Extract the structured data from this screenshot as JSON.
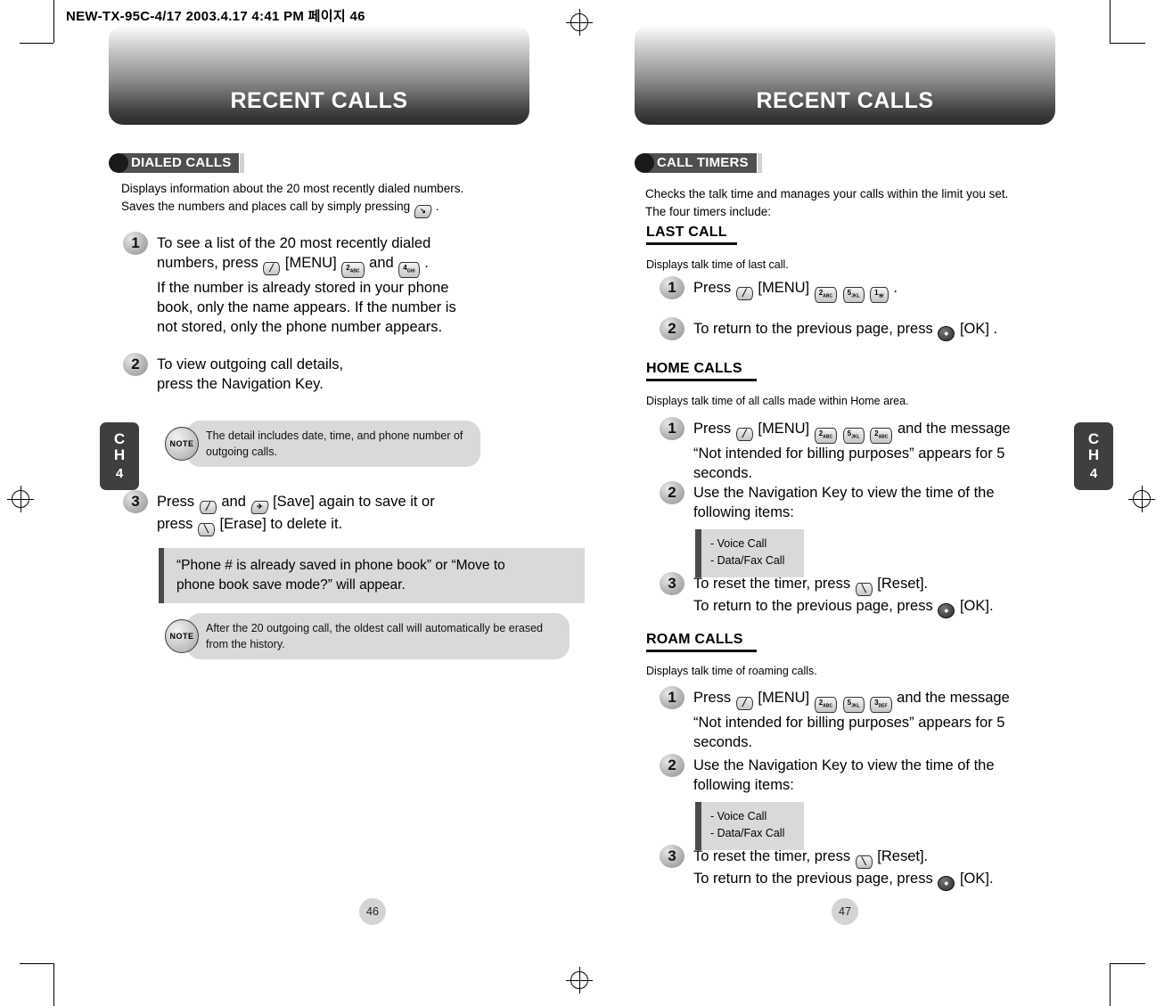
{
  "header_code": "NEW-TX-95C-4/17  2003.4.17 4:41 PM 페이지 46",
  "left_page": {
    "title": "RECENT CALLS",
    "section": "DIALED CALLS",
    "intro_line1": "Displays information about the 20 most recently dialed numbers.",
    "intro_line2_a": "Saves the numbers and places call by simply pressing",
    "intro_line2_b": ".",
    "steps": [
      {
        "num": "1",
        "text_a": "To see a list of the 20 most recently dialed",
        "text_b": "numbers, press",
        "menu": "[MENU]",
        "and": "and",
        "dot": ".",
        "text_c": "If the number is already stored in your phone",
        "text_d": "book, only the name appears. If the number is",
        "text_e": "not stored, only the phone number appears."
      },
      {
        "num": "2",
        "text_a": "To view outgoing call details,",
        "text_b": "press the Navigation Key."
      },
      {
        "num": "3",
        "text_a": "Press",
        "text_b": "and",
        "save": "[Save]",
        "text_c": "again to save it or",
        "text_d": "press",
        "erase": "[Erase]",
        "text_e": "to delete it."
      }
    ],
    "note1": "The detail includes date, time, and phone number of outgoing calls.",
    "note2": "After the 20 outgoing call, the oldest call will automatically be erased from the history.",
    "callout_a": "“Phone # is already saved in phone book” or “Move to",
    "callout_b": "phone book save mode?” will appear.",
    "note_badge": "NOTE",
    "page_number": "46",
    "chapter_letter_c": "CH",
    "chapter_number": "4"
  },
  "right_page": {
    "title": "RECENT CALLS",
    "section": "CALL TIMERS",
    "intro_line1": "Checks the talk time and manages your calls within the limit you set.",
    "intro_line2": "The four timers include:",
    "last_call": {
      "heading": "LAST CALL",
      "desc": "Displays talk time of last call.",
      "steps": [
        {
          "num": "1",
          "text_a": "Press",
          "menu": "[MENU]",
          "dot": "."
        },
        {
          "num": "2",
          "text_a": "To return to the previous page, press",
          "ok": "[OK] ."
        }
      ]
    },
    "home_calls": {
      "heading": "HOME CALLS",
      "desc": "Displays talk time of all calls made within Home area.",
      "steps": [
        {
          "num": "1",
          "text_a": "Press",
          "menu": "[MENU]",
          "text_b": "and the message",
          "text_c": "“Not intended for billing purposes” appears for 5",
          "text_d": "seconds."
        },
        {
          "num": "2",
          "text_a": "Use the Navigation Key to view the time of the",
          "text_b": "following items:"
        },
        {
          "num": "3",
          "text_a": "To reset the timer, press",
          "reset": "[Reset].",
          "text_b": "To return to the previous page, press",
          "ok": "[OK]."
        }
      ],
      "items": [
        "- Voice Call",
        "- Data/Fax Call"
      ]
    },
    "roam_calls": {
      "heading": "ROAM CALLS",
      "desc": "Displays talk time of roaming calls.",
      "steps": [
        {
          "num": "1",
          "text_a": "Press",
          "menu": "[MENU]",
          "text_b": "and the message",
          "text_c": "“Not intended for billing purposes” appears for 5",
          "text_d": "seconds."
        },
        {
          "num": "2",
          "text_a": "Use the Navigation Key to view the time of the",
          "text_b": "following items:"
        },
        {
          "num": "3",
          "text_a": "To reset the timer, press",
          "reset": "[Reset].",
          "text_b": "To return to the previous page, press",
          "ok": "[OK]."
        }
      ],
      "items": [
        "- Voice Call",
        "- Data/Fax Call"
      ]
    },
    "page_number": "47",
    "chapter_letter_c": "CH",
    "chapter_number": "4"
  },
  "keys": {
    "send": "↘",
    "menu_soft": "╱",
    "num2": "2ᴀᴃᴄ",
    "num3": "3ᴅᴇᴟ",
    "num4": "4ɢʜɪ",
    "num5": "5ᴊᴋʟ",
    "num1": "1⌂",
    "ok": "●",
    "left_soft": "╱",
    "right_soft": "╲"
  }
}
